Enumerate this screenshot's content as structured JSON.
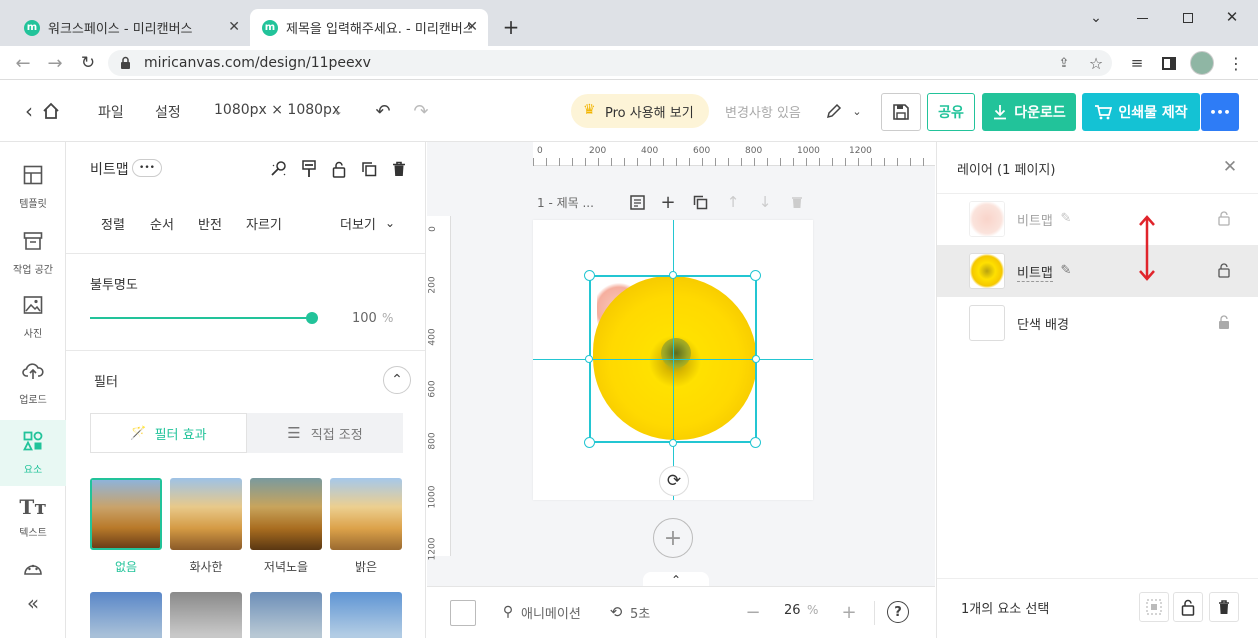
{
  "browser": {
    "tabs": [
      {
        "label": "워크스페이스 - 미리캔버스"
      },
      {
        "label": "제목을 입력해주세요. - 미리캔버스"
      }
    ],
    "url": "miricanvas.com/design/11peexv"
  },
  "header": {
    "file": "파일",
    "settings": "설정",
    "size": "1080px × 1080px",
    "pro": "Pro 사용해 보기",
    "changes": "변경사항 있음",
    "share": "공유",
    "download": "다운로드",
    "print": "인쇄물 제작",
    "more": "•••"
  },
  "nav": {
    "items": [
      {
        "label": "템플릿"
      },
      {
        "label": "작업 공간"
      },
      {
        "label": "사진"
      },
      {
        "label": "업로드"
      },
      {
        "label": "요소"
      },
      {
        "label": "텍스트"
      }
    ]
  },
  "panel": {
    "title": "비트맵",
    "more_dots": "•••",
    "tools": [
      "정렬",
      "순서",
      "반전",
      "자르기"
    ],
    "more_label": "더보기",
    "opacity_label": "불투명도",
    "opacity_value": "100",
    "opacity_unit": "%",
    "opacity_level": 1.0,
    "filter_label": "필터",
    "filter_tab_effect": "필터 효과",
    "filter_tab_adjust": "직접 조정",
    "filters": [
      {
        "label": "없음"
      },
      {
        "label": "화사한"
      },
      {
        "label": "저녁노을"
      },
      {
        "label": "밝은"
      }
    ]
  },
  "canvas": {
    "page_label": "1 - 제목 ...",
    "ruler_top": [
      "0",
      "200",
      "400",
      "600",
      "800",
      "1000",
      "1200"
    ],
    "ruler_left": [
      "0",
      "200",
      "400",
      "600",
      "800",
      "1000",
      "1200"
    ],
    "zoom_value": "26",
    "zoom_unit": "%",
    "animation_label": "애니메이션",
    "duration_label": "5초",
    "help": "?"
  },
  "layers": {
    "title": "레이어 (1 페이지)",
    "items": [
      {
        "label": "비트맵"
      },
      {
        "label": "비트맵"
      },
      {
        "label": "단색 배경"
      }
    ],
    "selection_status": "1개의 요소 선택"
  },
  "colors": {
    "accent": "#22c39a",
    "selection": "#23c6d2",
    "cyan_button": "#14c2d4",
    "blue_button": "#2e7cf6",
    "arrow": "#e0242b"
  }
}
